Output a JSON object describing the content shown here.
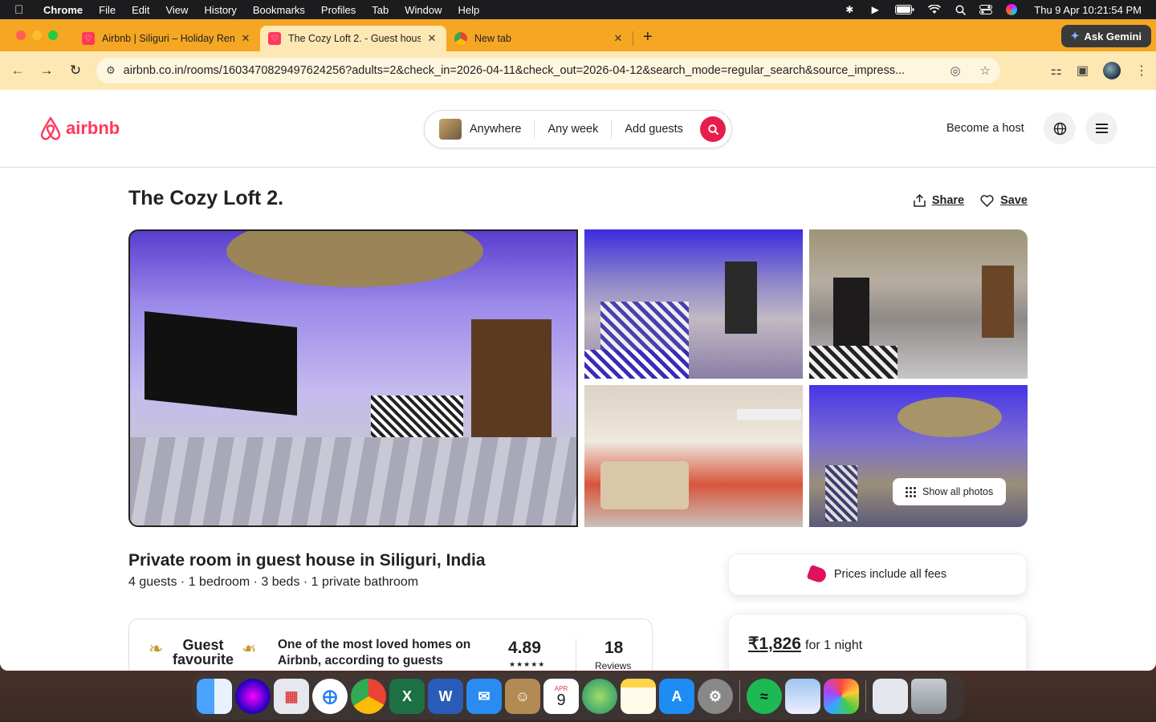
{
  "menubar": {
    "app_name": "Chrome",
    "items": [
      "File",
      "Edit",
      "View",
      "History",
      "Bookmarks",
      "Profiles",
      "Tab",
      "Window",
      "Help"
    ],
    "datetime": "Thu 9 Apr  10:21:54 PM"
  },
  "browser": {
    "tabs": [
      {
        "title": "Airbnb | Siliguri – Holiday Ren",
        "favicon": "airbnb-icon"
      },
      {
        "title": "The Cozy Loft 2. - Guest hous",
        "favicon": "airbnb-icon"
      },
      {
        "title": "New tab",
        "favicon": "chrome-icon"
      }
    ],
    "gemini_label": "Ask Gemini",
    "url": "airbnb.co.in/rooms/1603470829497624256?adults=2&check_in=2026-04-11&check_out=2026-04-12&search_mode=regular_search&source_impress..."
  },
  "header": {
    "logo_text": "airbnb",
    "search": {
      "where": "Anywhere",
      "when": "Any week",
      "who": "Add guests"
    },
    "become_host": "Become a host"
  },
  "listing": {
    "title": "The Cozy Loft 2.",
    "share_label": "Share",
    "save_label": "Save",
    "show_all_photos": "Show all photos",
    "subtitle": "Private room in guest house in Siliguri, India",
    "details": "4 guests · 1 bedroom · 3 beds · 1 private bathroom",
    "guest_favourite": {
      "badge_line1": "Guest",
      "badge_line2": "favourite",
      "description": "One of the most loved homes on Airbnb, according to guests",
      "rating": "4.89",
      "stars": "★★★★★",
      "reviews_count": "18",
      "reviews_label": "Reviews"
    }
  },
  "booking": {
    "fees_note": "Prices include all fees",
    "price": "₹1,826",
    "price_suffix": "for 1 night"
  },
  "dock": {
    "apps": [
      "Finder",
      "Siri",
      "Launchpad",
      "Safari",
      "Chrome",
      "Excel",
      "Word",
      "Mail",
      "Contacts",
      "Calendar",
      "Maps",
      "Notes",
      "App Store",
      "System Settings",
      "Spotify",
      "Preview",
      "Photos",
      "Downloads",
      "Trash"
    ],
    "calendar_month": "APR",
    "calendar_day": "9"
  }
}
